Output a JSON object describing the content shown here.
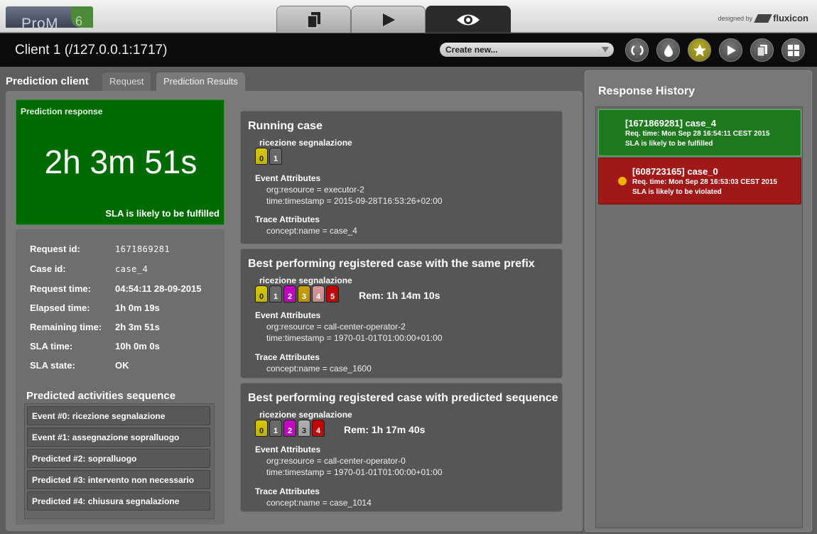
{
  "app": {
    "logo_text": "ProM",
    "logo_version": "6",
    "designed_by": "designed by",
    "designed_brand": "fluxicon",
    "view_tabs": [
      {
        "icon": "copy-icon"
      },
      {
        "icon": "play-icon"
      },
      {
        "icon": "eye-icon",
        "active": true
      }
    ]
  },
  "header": {
    "client_title": "Client 1 (/127.0.0.1:1717)",
    "create_new": "Create new...",
    "buttons": [
      {
        "icon": "refresh-icon"
      },
      {
        "icon": "drop-icon"
      },
      {
        "icon": "star-icon",
        "active": true
      },
      {
        "icon": "play-icon"
      },
      {
        "icon": "copy-icon"
      },
      {
        "icon": "grid-icon"
      }
    ]
  },
  "panel": {
    "label": "Prediction client",
    "tabs": [
      {
        "label": "Request"
      },
      {
        "label": "Prediction Results",
        "active": true
      }
    ]
  },
  "response": {
    "title": "Prediction response",
    "value": "2h 3m 51s",
    "sla_text": "SLA is likely to be fulfilled"
  },
  "info": {
    "rows": [
      {
        "label": "Request id:",
        "value": "1671869281",
        "mono": true
      },
      {
        "label": "Case id:",
        "value": "case_4",
        "mono": true
      },
      {
        "label": "Request time:",
        "value": "04:54:11 28-09-2015"
      },
      {
        "label": "Elapsed time:",
        "value": "1h 0m 19s"
      },
      {
        "label": "Remaining time:",
        "value": "2h 3m 51s"
      },
      {
        "label": "SLA time:",
        "value": "10h 0m 0s"
      },
      {
        "label": "SLA state:",
        "value": "OK"
      }
    ],
    "pas_title": "Predicted activities sequence",
    "pas_items": [
      "Event #0: ricezione segnalazione",
      "Event #1: assegnazione sopralluogo",
      "Predicted #2: sopralluogo",
      "Predicted #3: intervento non necessario",
      "Predicted #4: chiusura segnalazione"
    ]
  },
  "cards": [
    {
      "title": "Running case",
      "activity": "ricezione segnalazione",
      "boxes": [
        {
          "n": "0",
          "color": "#d8c800"
        },
        {
          "n": "1",
          "color": "#6a6a6a"
        }
      ],
      "rem": "",
      "event_attributes_label": "Event Attributes",
      "event_attributes": [
        "org:resource = executor-2",
        "time:timestamp = 2015-09-28T16:53:26+02:00"
      ],
      "trace_attributes_label": "Trace Attributes",
      "trace_attributes": [
        "concept:name = case_4"
      ]
    },
    {
      "title": "Best performing registered case with the same prefix",
      "activity": "ricezione segnalazione",
      "boxes": [
        {
          "n": "0",
          "color": "#d8c800"
        },
        {
          "n": "1",
          "color": "#6a6a6a"
        },
        {
          "n": "2",
          "color": "#c800c8"
        },
        {
          "n": "3",
          "color": "#c8a000"
        },
        {
          "n": "4",
          "color": "#d89898"
        },
        {
          "n": "5",
          "color": "#c80000"
        }
      ],
      "rem": "Rem: 1h 14m 10s",
      "event_attributes_label": "Event Attributes",
      "event_attributes": [
        "org:resource = call-center-operator-2",
        "time:timestamp = 1970-01-01T01:00:00+01:00"
      ],
      "trace_attributes_label": "Trace Attributes",
      "trace_attributes": [
        "concept:name = case_1600"
      ]
    },
    {
      "title": "Best performing registered case with predicted sequence",
      "activity": "ricezione segnalazione",
      "boxes": [
        {
          "n": "0",
          "color": "#d8c800"
        },
        {
          "n": "1",
          "color": "#6a6a6a"
        },
        {
          "n": "2",
          "color": "#c800c8"
        },
        {
          "n": "3",
          "color": "#b0b0b0"
        },
        {
          "n": "4",
          "color": "#c80000"
        }
      ],
      "rem": "Rem: 1h 17m 40s",
      "event_attributes_label": "Event Attributes",
      "event_attributes": [
        "org:resource = call-center-operator-0",
        "time:timestamp = 1970-01-01T01:00:00+01:00"
      ],
      "trace_attributes_label": "Trace Attributes",
      "trace_attributes": [
        "concept:name = case_1014"
      ]
    }
  ],
  "history": {
    "title": "Response History",
    "items": [
      {
        "id": "[1671869281] case_4",
        "req": "Req. time: Mon Sep 28 16:54:11 CEST 2015",
        "sla": "SLA is likely to be fulfilled",
        "status": "fulfilled",
        "bg": "#1f7a1f"
      },
      {
        "id": "[608723165] case_0",
        "req": "Req. time: Mon Sep 28 16:53:03 CEST 2015",
        "sla": "SLA is likely to be violated",
        "status": "violated",
        "bg": "#a01818"
      }
    ]
  }
}
